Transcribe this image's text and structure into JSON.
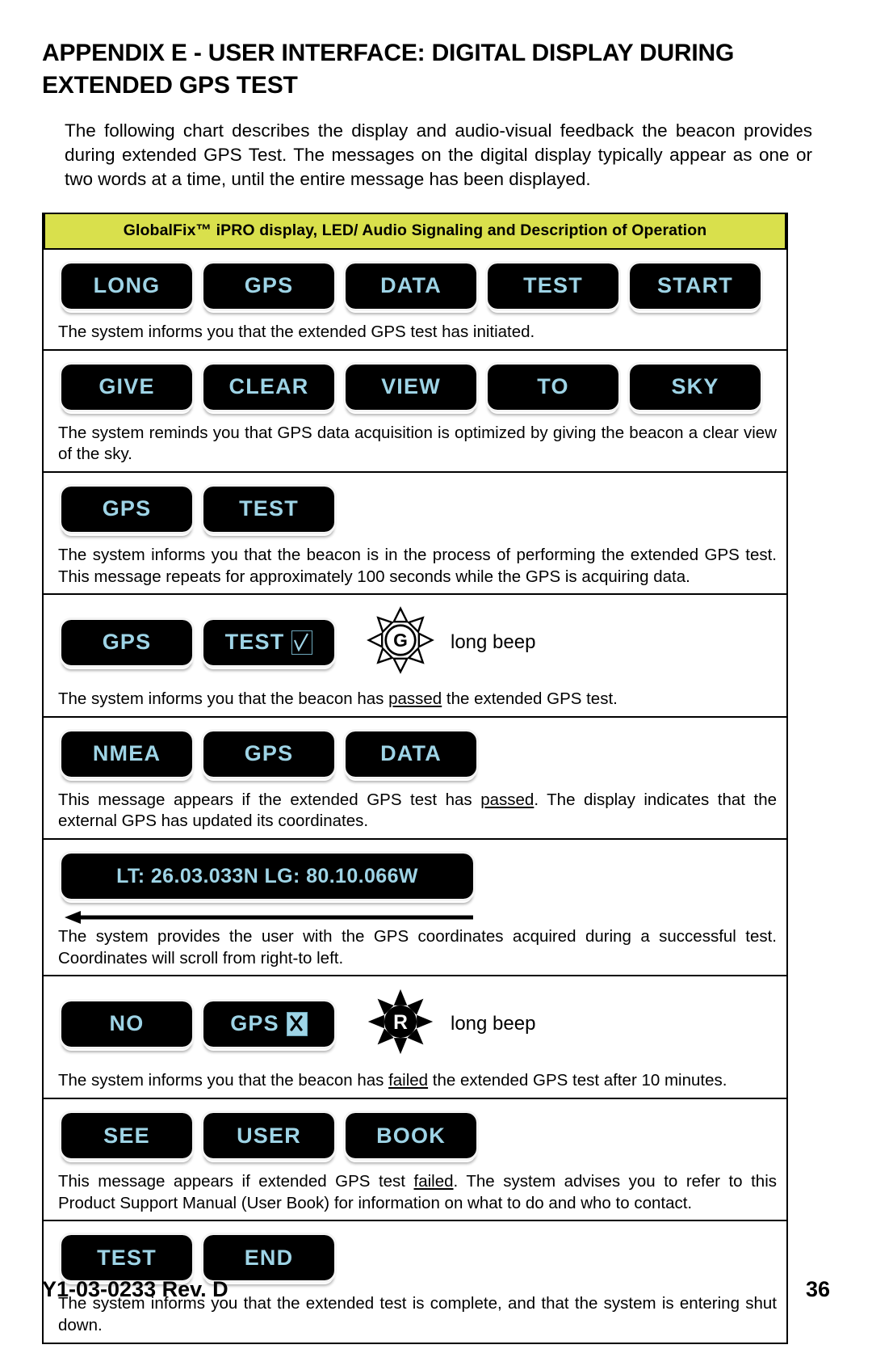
{
  "document": {
    "title": "APPENDIX E - USER INTERFACE: DIGITAL DISPLAY DURING EXTENDED GPS TEST",
    "intro": "The following chart describes the display and audio-visual feedback the beacon provides during extended GPS Test. The messages on the digital display typically appear as one or two words at a time, until the entire message has been displayed."
  },
  "chart": {
    "header": "GlobalFix™ iPRO display, LED/ Audio Signaling and Description of Operation",
    "lcd_text_color": "#9ed4e6",
    "header_bg_color": "#d9e04c",
    "rows": [
      {
        "segments": [
          {
            "text": "LONG"
          },
          {
            "text": "GPS"
          },
          {
            "text": "DATA"
          },
          {
            "text": "TEST"
          },
          {
            "text": "START"
          }
        ],
        "led": null,
        "audio": null,
        "description": "The system informs you that the extended GPS test has initiated."
      },
      {
        "segments": [
          {
            "text": "GIVE"
          },
          {
            "text": "CLEAR"
          },
          {
            "text": "VIEW"
          },
          {
            "text": "TO"
          },
          {
            "text": "SKY"
          }
        ],
        "led": null,
        "audio": null,
        "description": "The system reminds you that GPS data acquisition is optimized by giving the beacon a clear view of the sky."
      },
      {
        "segments": [
          {
            "text": "GPS"
          },
          {
            "text": "TEST"
          }
        ],
        "led": null,
        "audio": null,
        "description": "The system informs you that the beacon is in the process of performing the extended GPS test. This message repeats for approximately 100 seconds while the GPS is acquiring data."
      },
      {
        "segments": [
          {
            "text": "GPS"
          },
          {
            "text": "TEST",
            "mark": "check"
          }
        ],
        "led": "green-gps-led",
        "led_letter": "G",
        "audio": "long beep",
        "description_pre": "The system informs you that the beacon has ",
        "description_em": "passed",
        "description_post": " the extended GPS test.",
        "description": "The system informs you that the beacon has passed the extended GPS test."
      },
      {
        "segments": [
          {
            "text": "NMEA"
          },
          {
            "text": "GPS"
          },
          {
            "text": "DATA"
          }
        ],
        "led": null,
        "audio": null,
        "description_pre": "This message appears if the extended GPS test has ",
        "description_em": "passed",
        "description_post": ". The display indicates that the external GPS has updated its coordinates.",
        "description": "This message appears if the extended GPS test has passed. The display indicates that the external GPS has updated its coordinates."
      },
      {
        "segments": [
          {
            "text": "LT: 26.03.033N LG: 80.10.066W",
            "wide": true
          }
        ],
        "scroll_arrow": "left",
        "led": null,
        "audio": null,
        "description": "The system provides the user with the GPS coordinates acquired during a successful test. Coordinates will scroll from right-to left."
      },
      {
        "segments": [
          {
            "text": "NO"
          },
          {
            "text": "GPS",
            "mark": "cross"
          }
        ],
        "led": "red-gps-led",
        "led_letter": "R",
        "audio": "long beep",
        "description_pre": "The system informs you that the beacon has ",
        "description_em": "failed",
        "description_post": " the extended GPS test after 10 minutes.",
        "description": "The system informs you that the beacon has failed the extended GPS test after 10 minutes."
      },
      {
        "segments": [
          {
            "text": "SEE"
          },
          {
            "text": "USER"
          },
          {
            "text": "BOOK"
          }
        ],
        "led": null,
        "audio": null,
        "description_pre": "This message appears if extended GPS test ",
        "description_em": "failed",
        "description_post": ". The system advises you to refer to this Product Support Manual (User Book) for information on what to do and who to contact.",
        "description": "This message appears if extended GPS test failed. The system advises you to refer to this Product Support Manual (User Book) for information on what to do and who to contact."
      },
      {
        "segments": [
          {
            "text": "TEST"
          },
          {
            "text": "END"
          }
        ],
        "led": null,
        "audio": null,
        "description": "The system informs you that the extended test is complete, and that the system is entering shut down."
      }
    ]
  },
  "footer": {
    "doc_number": "Y1-03-0233 Rev. D",
    "page_number": "36"
  }
}
